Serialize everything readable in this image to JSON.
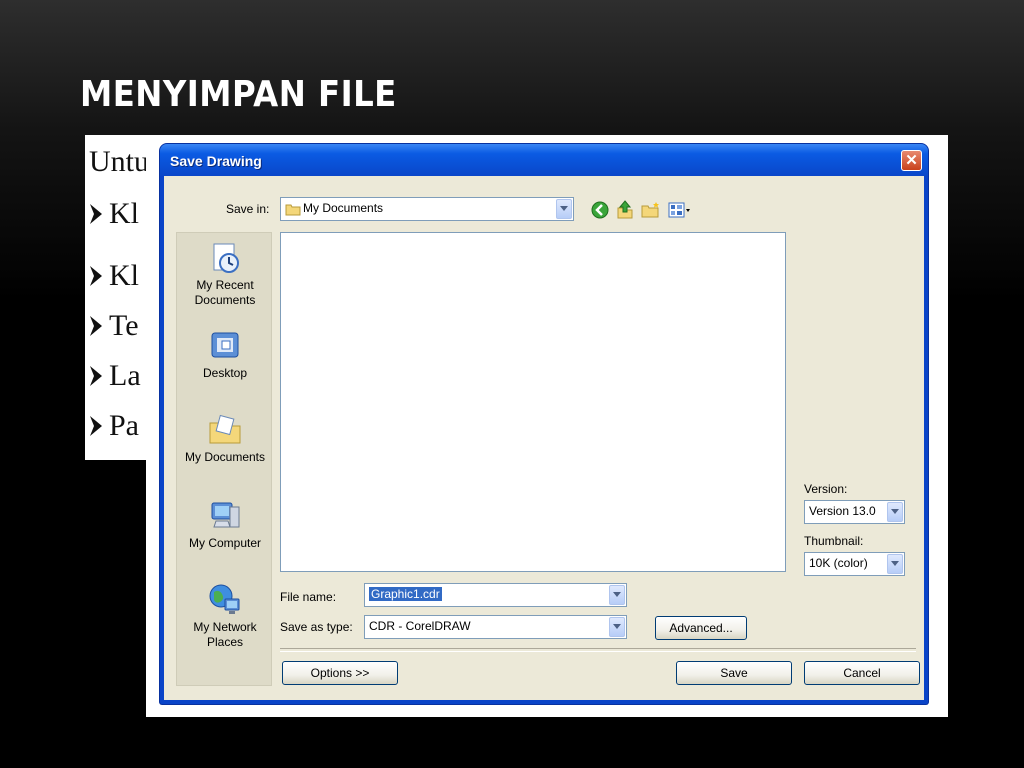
{
  "slide": {
    "title": "MENYIMPAN FILE"
  },
  "doc_strip": {
    "lines": [
      "Untul",
      "Kl",
      "Kl",
      "Te",
      "La",
      "Pa"
    ]
  },
  "dialog": {
    "title": "Save Drawing",
    "save_in_label": "Save in:",
    "save_in_value": "My Documents",
    "places": [
      {
        "label": "My Recent Documents",
        "icon": "recent-documents-icon"
      },
      {
        "label": "Desktop",
        "icon": "desktop-icon"
      },
      {
        "label": "My Documents",
        "icon": "my-documents-icon"
      },
      {
        "label": "My Computer",
        "icon": "my-computer-icon"
      },
      {
        "label": "My Network Places",
        "icon": "network-places-icon"
      }
    ],
    "version_label": "Version:",
    "version_value": "Version 13.0",
    "thumbnail_label": "Thumbnail:",
    "thumbnail_value": "10K (color)",
    "file_name_label": "File name:",
    "file_name_value": "Graphic1.cdr",
    "save_as_type_label": "Save as type:",
    "save_as_type_value": "CDR - CorelDRAW",
    "advanced_button": "Advanced...",
    "options_button": "Options >>",
    "save_button": "Save",
    "cancel_button": "Cancel",
    "colors": {
      "titlebar": "#0a4fd4",
      "face": "#ece9d8",
      "selection": "#316ac5"
    }
  }
}
